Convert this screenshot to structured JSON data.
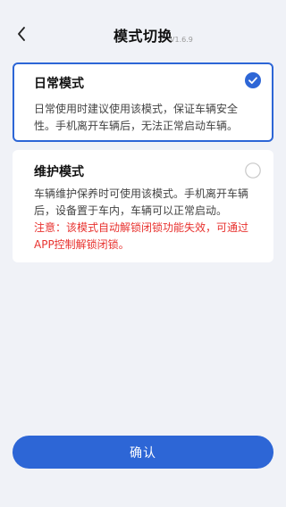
{
  "header": {
    "title": "模式切换",
    "version": "V1.6.9"
  },
  "modes": [
    {
      "title": "日常模式",
      "description": "日常使用时建议使用该模式，保证车辆安全性。手机离开车辆后，无法正常启动车辆。",
      "selected": true
    },
    {
      "title": "维护模式",
      "description": "车辆维护保养时可使用该模式。手机离开车辆后，设备置于车内，车辆可以正常启动。",
      "note": "注意：该模式自动解锁闭锁功能失效，可通过APP控制解锁闭锁。",
      "selected": false
    }
  ],
  "footer": {
    "confirm_label": "确认"
  },
  "colors": {
    "accent": "#2d66d6",
    "warning": "#e8322f",
    "background": "#f0f2f7"
  }
}
